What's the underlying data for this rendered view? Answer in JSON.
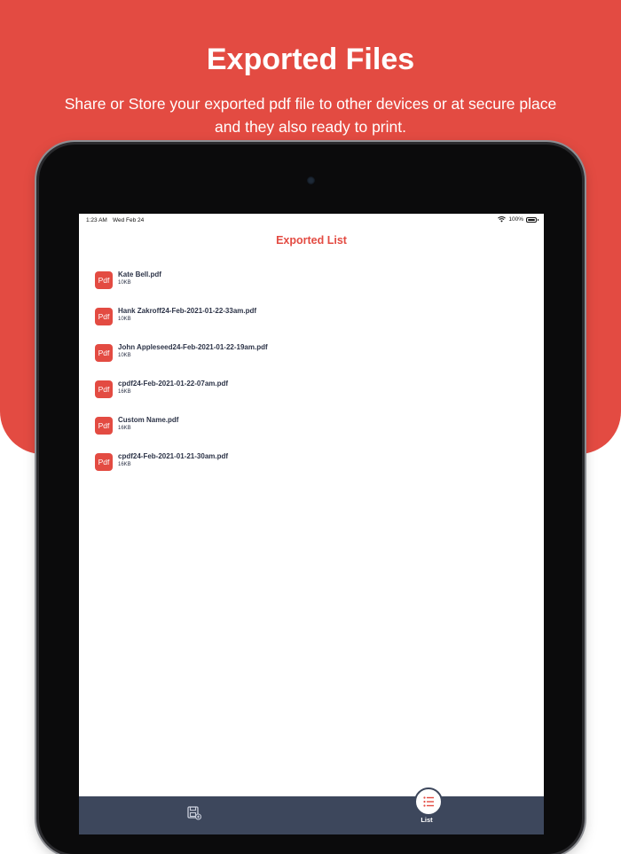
{
  "hero": {
    "title": "Exported Files",
    "subtitle": "Share or Store your exported pdf file to other devices or at secure place and they also ready to print."
  },
  "status_bar": {
    "time": "1:23 AM",
    "date": "Wed Feb 24",
    "battery": "100%"
  },
  "screen": {
    "title": "Exported List"
  },
  "files": [
    {
      "icon_label": "Pdf",
      "name": "Kate Bell.pdf",
      "size": "10KB"
    },
    {
      "icon_label": "Pdf",
      "name": "Hank Zakroff24-Feb-2021-01-22-33am.pdf",
      "size": "10KB"
    },
    {
      "icon_label": "Pdf",
      "name": "John Appleseed24-Feb-2021-01-22-19am.pdf",
      "size": "10KB"
    },
    {
      "icon_label": "Pdf",
      "name": "cpdf24-Feb-2021-01-22-07am.pdf",
      "size": "16KB"
    },
    {
      "icon_label": "Pdf",
      "name": "Custom Name.pdf",
      "size": "16KB"
    },
    {
      "icon_label": "Pdf",
      "name": "cpdf24-Feb-2021-01-21-30am.pdf",
      "size": "16KB"
    }
  ],
  "tabbar": {
    "tabs": [
      {
        "icon": "save-document-icon",
        "label": ""
      },
      {
        "icon": "list-icon",
        "label": "List"
      }
    ]
  },
  "colors": {
    "accent": "#e34b42",
    "tabbar": "#3d475c",
    "text": "#2c3347"
  }
}
